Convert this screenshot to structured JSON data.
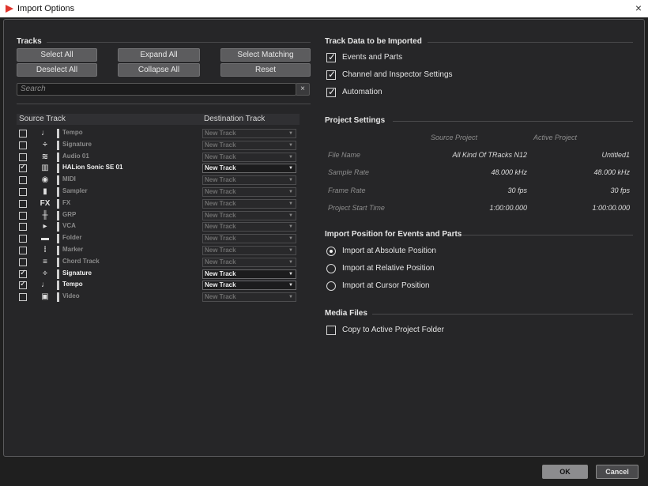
{
  "window": {
    "title": "Import Options",
    "close": "×"
  },
  "tracks": {
    "title": "Tracks",
    "buttons": {
      "select_all": "Select All",
      "expand_all": "Expand All",
      "select_matching": "Select Matching",
      "deselect_all": "Deselect All",
      "collapse_all": "Collapse All",
      "reset": "Reset"
    },
    "search_placeholder": "Search",
    "search_clear": "×",
    "columns": {
      "source": "Source Track",
      "destination": "Destination Track"
    },
    "rows": [
      {
        "checked": false,
        "icon": "♩",
        "name": "Tempo",
        "dest": "New Track",
        "active": false
      },
      {
        "checked": false,
        "icon": "÷",
        "name": "Signature",
        "dest": "New Track",
        "active": false
      },
      {
        "checked": false,
        "icon": "≋",
        "name": "Audio 01",
        "dest": "New Track",
        "active": false
      },
      {
        "checked": true,
        "icon": "▥",
        "name": "HALion Sonic SE 01",
        "dest": "New Track",
        "active": true
      },
      {
        "checked": false,
        "icon": "◉",
        "name": "MIDI",
        "dest": "New Track",
        "active": false
      },
      {
        "checked": false,
        "icon": "▮",
        "name": "Sampler",
        "dest": "New Track",
        "active": false
      },
      {
        "checked": false,
        "icon": "FX",
        "name": "FX",
        "dest": "New Track",
        "active": false
      },
      {
        "checked": false,
        "icon": "╫",
        "name": "GRP",
        "dest": "New Track",
        "active": false
      },
      {
        "checked": false,
        "icon": "▸",
        "name": "VCA",
        "dest": "New Track",
        "active": false
      },
      {
        "checked": false,
        "icon": "▬",
        "name": "Folder",
        "dest": "New Track",
        "active": false
      },
      {
        "checked": false,
        "icon": "⁞",
        "name": "Marker",
        "dest": "New Track",
        "active": false
      },
      {
        "checked": false,
        "icon": "≡",
        "name": "Chord Track",
        "dest": "New Track",
        "active": false
      },
      {
        "checked": true,
        "icon": "÷",
        "name": "Signature",
        "dest": "New Track",
        "active": true
      },
      {
        "checked": true,
        "icon": "♩",
        "name": "Tempo",
        "dest": "New Track",
        "active": true
      },
      {
        "checked": false,
        "icon": "▣",
        "name": "Video",
        "dest": "New Track",
        "active": false
      }
    ]
  },
  "track_data": {
    "title": "Track Data to be Imported",
    "options": [
      {
        "label": "Events and Parts",
        "checked": true
      },
      {
        "label": "Channel and Inspector Settings",
        "checked": true
      },
      {
        "label": "Automation",
        "checked": true
      }
    ]
  },
  "project_settings": {
    "title": "Project Settings",
    "source_header": "Source Project",
    "active_header": "Active Project",
    "rows": [
      {
        "label": "File Name",
        "source": "All Kind Of TRacks N12",
        "active": "Untitled1"
      },
      {
        "label": "Sample Rate",
        "source": "48.000 kHz",
        "active": "48.000 kHz"
      },
      {
        "label": "Frame Rate",
        "source": "30 fps",
        "active": "30 fps"
      },
      {
        "label": "Project Start Time",
        "source": "1:00:00.000",
        "active": "1:00:00.000"
      }
    ]
  },
  "import_position": {
    "title": "Import Position for Events and Parts",
    "options": [
      {
        "label": "Import at Absolute Position",
        "selected": true
      },
      {
        "label": "Import at Relative Position",
        "selected": false
      },
      {
        "label": "Import at Cursor Position",
        "selected": false
      }
    ]
  },
  "media_files": {
    "title": "Media Files",
    "copy_label": "Copy to Active Project Folder",
    "copy_checked": false
  },
  "footer": {
    "ok": "OK",
    "cancel": "Cancel"
  },
  "colors": {
    "accent_red": "#e0342c",
    "ok_bg": "#8c8c8e",
    "cancel_bg": "#4a4a4c"
  }
}
